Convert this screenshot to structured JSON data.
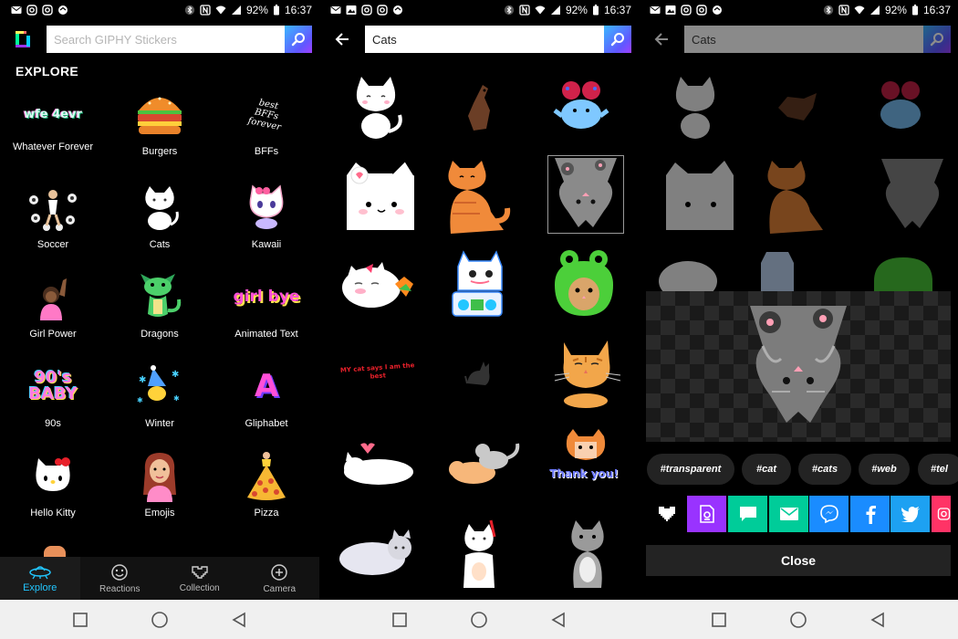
{
  "status": {
    "battery": "92%",
    "time": "16:37"
  },
  "panel1": {
    "search_placeholder": "Search GIPHY Stickers",
    "section_title": "EXPLORE",
    "categories": [
      {
        "label": "Whatever Forever",
        "art": "wfe 4evr"
      },
      {
        "label": "Burgers"
      },
      {
        "label": "BFFs",
        "art": "best BFFs forever"
      },
      {
        "label": "Soccer"
      },
      {
        "label": "Cats"
      },
      {
        "label": "Kawaii"
      },
      {
        "label": "Girl Power"
      },
      {
        "label": "Dragons"
      },
      {
        "label": "Animated Text",
        "art": "girl bye"
      },
      {
        "label": "90s",
        "art": "90's BABY"
      },
      {
        "label": "Winter"
      },
      {
        "label": "Gliphabet",
        "art": "A"
      },
      {
        "label": "Hello Kitty"
      },
      {
        "label": "Emojis"
      },
      {
        "label": "Pizza"
      }
    ],
    "nav": [
      {
        "label": "Explore",
        "icon": "ufo-icon",
        "active": true
      },
      {
        "label": "Reactions",
        "icon": "reactions-icon",
        "active": false
      },
      {
        "label": "Collection",
        "icon": "heart-icon",
        "active": false
      },
      {
        "label": "Camera",
        "icon": "camera-icon",
        "active": false
      }
    ]
  },
  "panel2": {
    "search_value": "Cats",
    "sticker_texts": {
      "cat_text": "MY cat says I am the best",
      "thank_you": "Thank you!"
    }
  },
  "panel3": {
    "search_value": "Cats",
    "tags": [
      "#transparent",
      "#cat",
      "#cats",
      "#web",
      "#tel"
    ],
    "share": [
      {
        "name": "favorite",
        "color": "#000000",
        "icon": "heart-icon"
      },
      {
        "name": "save",
        "color": "#9933ff",
        "icon": "download-icon"
      },
      {
        "name": "sms",
        "color": "#00cc99",
        "icon": "message-icon"
      },
      {
        "name": "email",
        "color": "#00cc99",
        "icon": "mail-icon"
      },
      {
        "name": "messenger",
        "color": "#1a8cff",
        "icon": "messenger-icon"
      },
      {
        "name": "facebook",
        "color": "#1a8cff",
        "icon": "facebook-icon"
      },
      {
        "name": "twitter",
        "color": "#1da1f2",
        "icon": "twitter-icon"
      },
      {
        "name": "instagram",
        "color": "#ff3366",
        "icon": "instagram-icon"
      }
    ],
    "close_label": "Close"
  },
  "colors": {
    "accent": "#22c6ff",
    "bg": "#000000",
    "surface": "#232323"
  }
}
